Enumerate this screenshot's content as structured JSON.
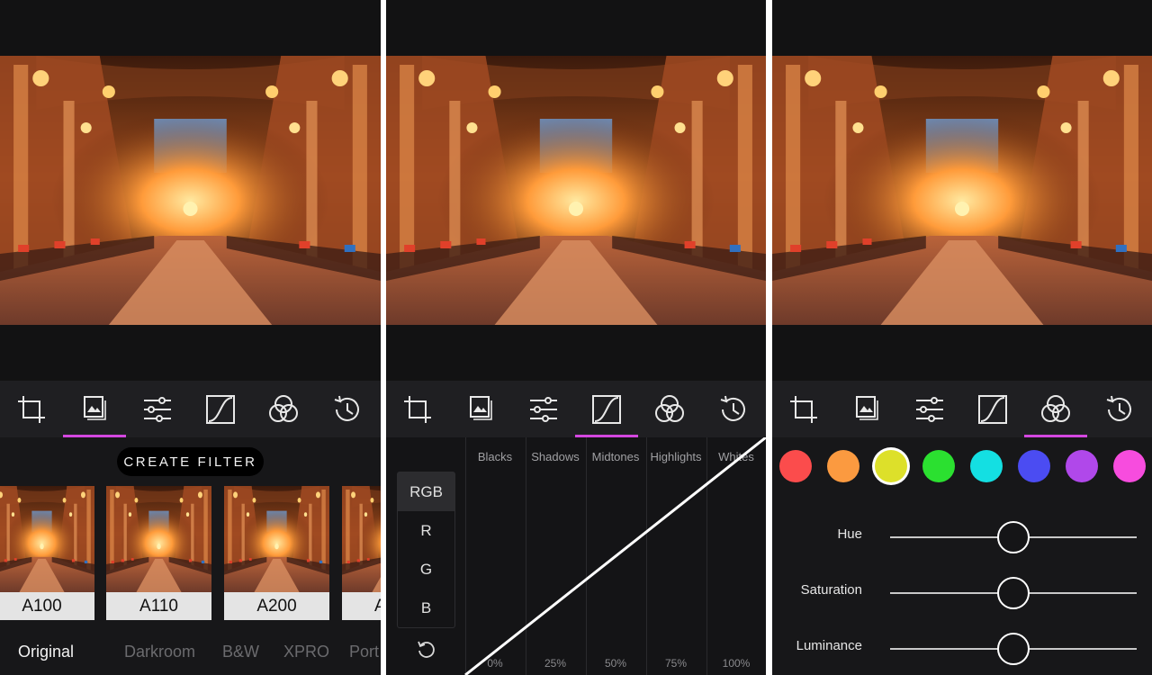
{
  "tools": [
    {
      "name": "crop-icon"
    },
    {
      "name": "filters-icon"
    },
    {
      "name": "adjust-icon"
    },
    {
      "name": "curves-icon"
    },
    {
      "name": "hsl-icon"
    },
    {
      "name": "history-icon"
    }
  ],
  "accent_color": "#d447e0",
  "panel1": {
    "active_tool": "filters-icon",
    "create_filter_label": "CREATE FILTER",
    "filters": [
      {
        "label": "A100"
      },
      {
        "label": "A110"
      },
      {
        "label": "A200"
      },
      {
        "label": "A"
      }
    ],
    "categories": [
      {
        "label": "Original",
        "selected": true
      },
      {
        "label": "Darkroom",
        "selected": false
      },
      {
        "label": "B&W",
        "selected": false
      },
      {
        "label": "XPRO",
        "selected": false
      },
      {
        "label": "Port",
        "selected": false
      }
    ]
  },
  "panel2": {
    "active_tool": "curves-icon",
    "channels": [
      {
        "label": "RGB",
        "selected": true
      },
      {
        "label": "R",
        "selected": false
      },
      {
        "label": "G",
        "selected": false
      },
      {
        "label": "B",
        "selected": false
      }
    ],
    "zones": [
      "Blacks",
      "Shadows",
      "Midtones",
      "Highlights",
      "Whites"
    ],
    "percents": [
      "0%",
      "25%",
      "50%",
      "75%",
      "100%"
    ],
    "reset_icon": "reset-icon"
  },
  "panel3": {
    "active_tool": "hsl-icon",
    "colors": [
      {
        "name": "red",
        "hex": "#fb4c4c",
        "selected": false
      },
      {
        "name": "orange",
        "hex": "#fb9a40",
        "selected": false
      },
      {
        "name": "yellow",
        "hex": "#dde02a",
        "selected": true
      },
      {
        "name": "green",
        "hex": "#2be030",
        "selected": false
      },
      {
        "name": "cyan",
        "hex": "#14dfe2",
        "selected": false
      },
      {
        "name": "blue",
        "hex": "#4b4cf2",
        "selected": false
      },
      {
        "name": "purple",
        "hex": "#b048ea",
        "selected": false
      },
      {
        "name": "magenta",
        "hex": "#f74cde",
        "selected": false
      }
    ],
    "sliders": [
      {
        "label": "Hue",
        "value": 0.5
      },
      {
        "label": "Saturation",
        "value": 0.5
      },
      {
        "label": "Luminance",
        "value": 0.5
      }
    ]
  }
}
